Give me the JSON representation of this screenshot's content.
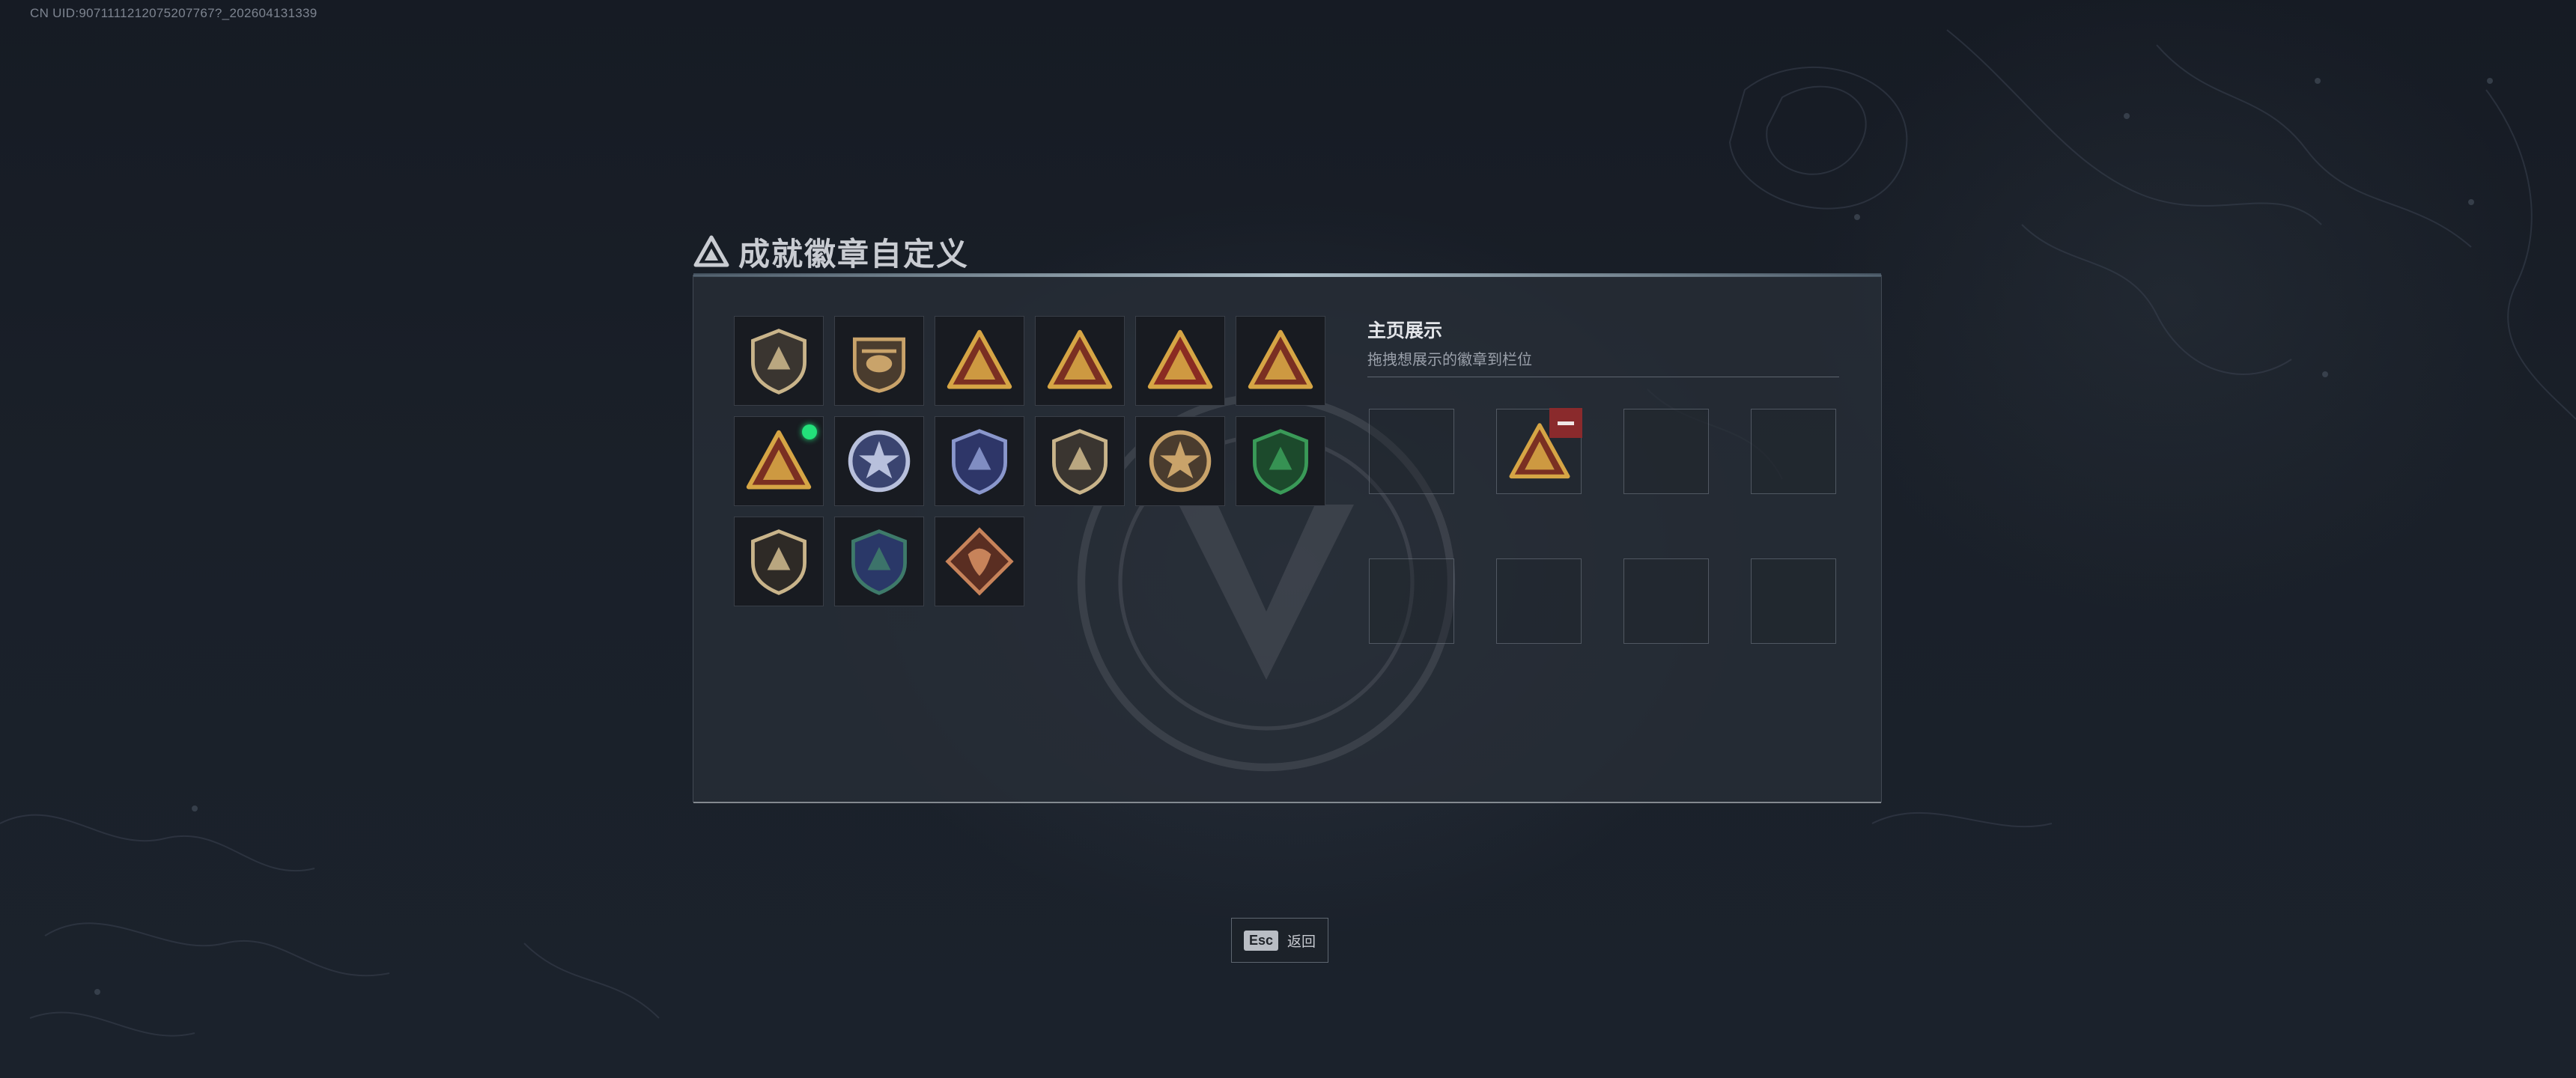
{
  "uid_text": "CN UID:9071111212075207767?_202604131339",
  "dialog": {
    "title": "成就徽章自定义",
    "title_icon": "triangle-logo-icon"
  },
  "badges": [
    {
      "name": "shield-triangle-badge",
      "colors": [
        "#c9b48a",
        "#3a3530"
      ]
    },
    {
      "name": "helicopter-badge",
      "colors": [
        "#c9a36a",
        "#4a3c2e"
      ]
    },
    {
      "name": "triangle-s6-badge",
      "colors": [
        "#d6a545",
        "#7a2f22"
      ]
    },
    {
      "name": "triangle-boat-badge",
      "colors": [
        "#d6a545",
        "#7a2f22"
      ]
    },
    {
      "name": "triangle-number-one-badge",
      "colors": [
        "#d6a545",
        "#8a2b22"
      ]
    },
    {
      "name": "triangle-soldiers-badge",
      "colors": [
        "#d6a545",
        "#7a2f22"
      ]
    },
    {
      "name": "triangle-rocket-badge",
      "colors": [
        "#d6a545",
        "#7a2f22"
      ],
      "is_new": true
    },
    {
      "name": "star-medal-badge",
      "colors": [
        "#b8c0dc",
        "#3a4470"
      ]
    },
    {
      "name": "blue-shield-badge",
      "colors": [
        "#8a97cc",
        "#2e3668"
      ]
    },
    {
      "name": "lion-shield-badge",
      "colors": [
        "#c9b48a",
        "#3a3530"
      ]
    },
    {
      "name": "round-emblem-badge",
      "colors": [
        "#c9a36a",
        "#4a3c2e"
      ]
    },
    {
      "name": "green-rifle-shield-badge",
      "colors": [
        "#3a9a58",
        "#1c4a2c"
      ]
    },
    {
      "name": "rifle-shield-badge",
      "colors": [
        "#c9b48a",
        "#2e2a26"
      ]
    },
    {
      "name": "wings-arrows-badge",
      "colors": [
        "#3e7a6a",
        "#2a3868"
      ]
    },
    {
      "name": "dragon-diamond-badge",
      "colors": [
        "#c7835a",
        "#5a2e22"
      ]
    }
  ],
  "showcase": {
    "heading": "主页展示",
    "subtitle": "拖拽想展示的徽章到栏位",
    "slots": [
      {
        "badge": null
      },
      {
        "badge": "triangle-rocket-badge"
      },
      {
        "badge": null
      },
      {
        "badge": null
      },
      {
        "badge": null
      },
      {
        "badge": null
      },
      {
        "badge": null
      },
      {
        "badge": null
      }
    ]
  },
  "footer": {
    "key": "Esc",
    "label": "返回"
  }
}
